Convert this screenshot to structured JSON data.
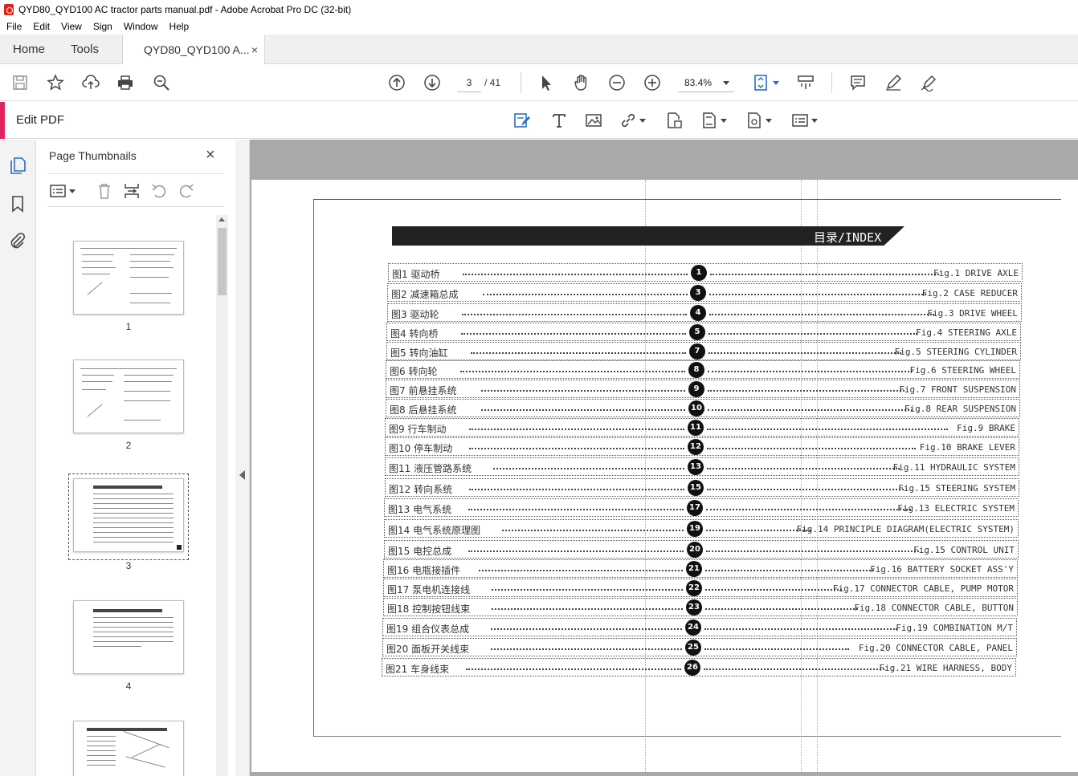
{
  "window": {
    "title": "QYD80_QYD100 AC tractor parts manual.pdf - Adobe Acrobat Pro DC (32-bit)"
  },
  "menu": [
    "File",
    "Edit",
    "View",
    "Sign",
    "Window",
    "Help"
  ],
  "tabs": {
    "home": "Home",
    "tools": "Tools",
    "document": "QYD80_QYD100 A...",
    "close": "×"
  },
  "toolbar": {
    "current_page": "3",
    "page_total": "/ 41",
    "zoom": "83.4%"
  },
  "edit_bar": {
    "label": "Edit PDF"
  },
  "thumbnails": {
    "title": "Page Thumbnails",
    "close": "×",
    "pages": [
      "1",
      "2",
      "3",
      "4"
    ],
    "selected_page": "3"
  },
  "document": {
    "header": "目录/INDEX",
    "rows": [
      {
        "cn": "图1  驱动桥",
        "num": "1",
        "en": "Fig.1 DRIVE AXLE"
      },
      {
        "cn": "图2  减速箱总成",
        "num": "3",
        "en": "Fig.2 CASE REDUCER"
      },
      {
        "cn": "图3  驱动轮",
        "num": "4",
        "en": "Fig.3 DRIVE WHEEL"
      },
      {
        "cn": "图4  转向桥",
        "num": "5",
        "en": "Fig.4 STEERING AXLE"
      },
      {
        "cn": "图5  转向油缸",
        "num": "7",
        "en": "Fig.5 STEERING CYLINDER"
      },
      {
        "cn": "图6  转向轮",
        "num": "8",
        "en": "Fig.6 STEERING WHEEL"
      },
      {
        "cn": "图7  前悬挂系统",
        "num": "9",
        "en": "Fig.7 FRONT SUSPENSION"
      },
      {
        "cn": "图8  后悬挂系统",
        "num": "10",
        "en": "Fig.8 REAR SUSPENSION"
      },
      {
        "cn": "图9  行车制动",
        "num": "11",
        "en": "Fig.9 BRAKE"
      },
      {
        "cn": "图10 停车制动",
        "num": "12",
        "en": "Fig.10 BRAKE LEVER"
      },
      {
        "cn": "图11 液压管路系统",
        "num": "13",
        "en": "Fig.11 HYDRAULIC SYSTEM"
      },
      {
        "cn": "图12 转向系统",
        "num": "15",
        "en": "Fig.15 STEERING SYSTEM"
      },
      {
        "cn": "图13 电气系统",
        "num": "17",
        "en": "Fig.13 ELECTRIC SYSTEM"
      },
      {
        "cn": "图14 电气系统原理图",
        "num": "19",
        "en": "Fig.14 PRINCIPLE DIAGRAM(ELECTRIC SYSTEM)"
      },
      {
        "cn": "图15 电控总成",
        "num": "20",
        "en": "Fig.15 CONTROL UNIT"
      },
      {
        "cn": "图16 电瓶接插件",
        "num": "21",
        "en": "Fig.16 BATTERY SOCKET ASS'Y"
      },
      {
        "cn": "图17 泵电机连接线",
        "num": "22",
        "en": "Fig.17 CONNECTOR CABLE, PUMP MOTOR"
      },
      {
        "cn": "图18 控制按钮线束",
        "num": "23",
        "en": "Fig.18 CONNECTOR CABLE, BUTTON"
      },
      {
        "cn": "图19 组合仪表总成",
        "num": "24",
        "en": "Fig.19 COMBINATION M/T"
      },
      {
        "cn": "图20 面板开关线束",
        "num": "25",
        "en": "Fig.20 CONNECTOR CABLE, PANEL"
      },
      {
        "cn": "图21 车身线束",
        "num": "26",
        "en": "Fig.21 WIRE HARNESS, BODY"
      }
    ]
  },
  "colors": {
    "accent": "#e0235c",
    "pdf_icon": "#d9251c",
    "doc_background": "#a9a9a9"
  }
}
